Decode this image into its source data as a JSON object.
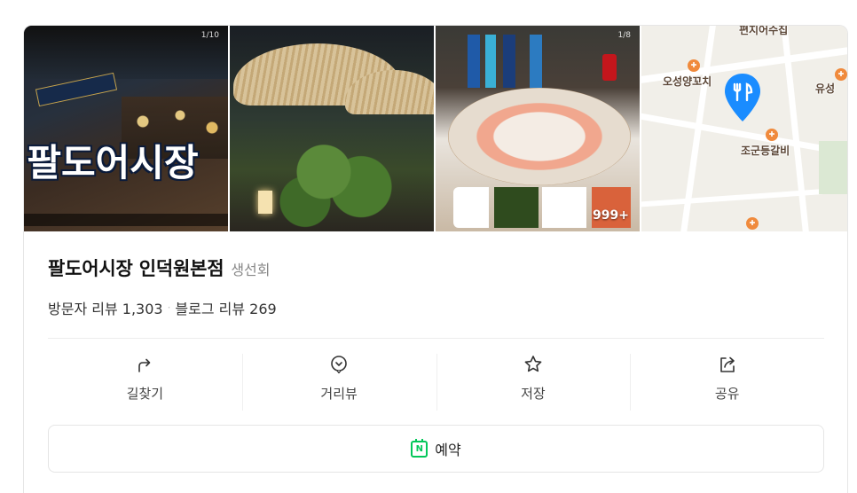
{
  "photos": {
    "photo1_count": "1/10",
    "photo1_sign": "팔도어시장",
    "photo3_count": "1/8",
    "more_count": "999+"
  },
  "map": {
    "labels": [
      "오성양꼬치",
      "조군등갈비",
      "유성",
      "편지어수집"
    ]
  },
  "place": {
    "name": "팔도어시장 인덕원본점",
    "category": "생선회",
    "visitor_reviews": "방문자 리뷰 1,303",
    "separator": "·",
    "blog_reviews": "블로그 리뷰 269"
  },
  "actions": [
    {
      "label": "길찾기",
      "icon": "directions-icon"
    },
    {
      "label": "거리뷰",
      "icon": "street-view-icon"
    },
    {
      "label": "저장",
      "icon": "star-icon"
    },
    {
      "label": "공유",
      "icon": "share-icon"
    }
  ],
  "reservation": {
    "label": "예약",
    "icon": "naver-calendar-icon"
  },
  "colors": {
    "naver_green": "#03c75a",
    "pin_blue": "#1a8cff"
  }
}
